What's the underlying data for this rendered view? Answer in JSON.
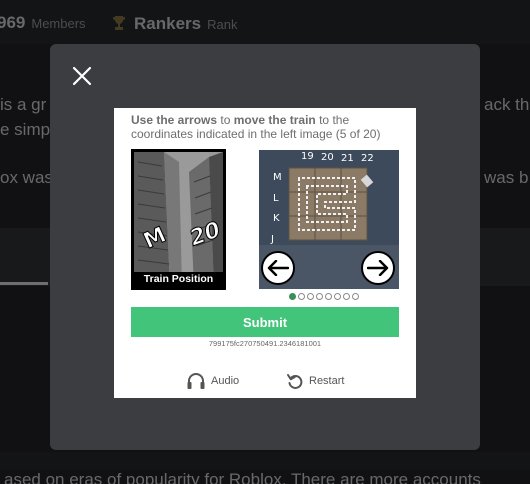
{
  "background": {
    "members_count": "969",
    "members_label": "Members",
    "rankers_title": "Rankers",
    "rankers_label": "Rank",
    "lines": [
      {
        "left": "is a gr",
        "right": "ack th"
      },
      {
        "left": "e simp",
        "right": ""
      },
      {
        "left": "ox was",
        "right": "was b"
      }
    ],
    "tab_label": "",
    "bottom_text": "ased on eras of popularity for Roblox. There are more accounts"
  },
  "modal": {
    "close_icon": "close-icon"
  },
  "captcha": {
    "instruction_bold_1": "Use the arrows",
    "instruction_text_1": " to ",
    "instruction_bold_2": "move the train",
    "instruction_text_2": " to the coordinates indicated in the left image (5 of 20)",
    "left_caption": "Train Position",
    "left_letter": "M",
    "left_number": "20",
    "grid_columns": [
      "19",
      "20",
      "21",
      "22"
    ],
    "grid_rows": [
      "M",
      "L",
      "K",
      "J"
    ],
    "dots_total": 8,
    "dots_active_index": 0,
    "submit_label": "Submit",
    "session_id": "799175fc270750491.2346181001",
    "audio_label": "Audio",
    "restart_label": "Restart",
    "colors": {
      "submit": "#42c47a",
      "dot_active": "#3a8f56",
      "grid_bg": "#3d4a5c"
    }
  }
}
